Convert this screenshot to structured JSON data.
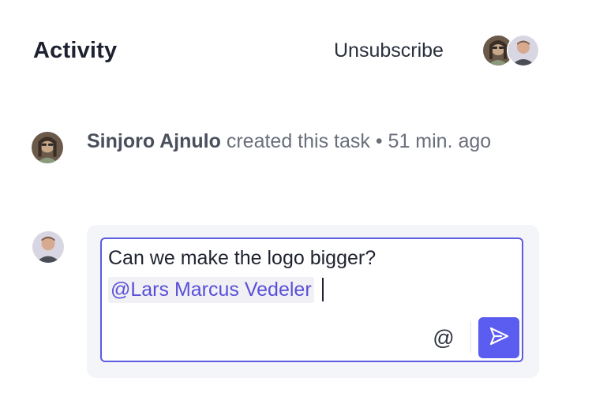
{
  "header": {
    "title": "Activity",
    "unsubscribe_label": "Unsubscribe",
    "subscribers": [
      {
        "icon": "avatar-photo-woman"
      },
      {
        "icon": "avatar-photo-man"
      }
    ]
  },
  "activity": {
    "events": [
      {
        "actor": "Sinjoro Ajnulo",
        "action": "created this task",
        "separator": "•",
        "time": "51 min. ago"
      }
    ]
  },
  "composer": {
    "text_line": "Can we make the logo bigger?",
    "mention": "@Lars Marcus Vedeler",
    "mention_button_label": "@",
    "send_icon": "send-icon"
  },
  "colors": {
    "accent": "#5b5cf0",
    "mention_text": "#5a4fd8",
    "composer_border": "#5b5ce0",
    "composer_bg": "#f4f5f8"
  }
}
